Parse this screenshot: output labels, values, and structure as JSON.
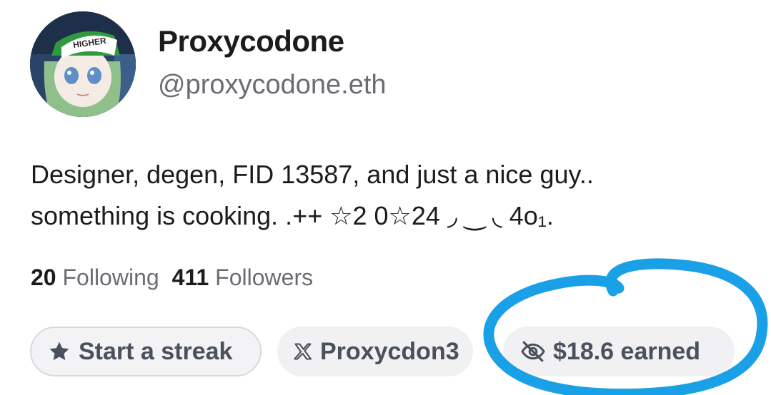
{
  "profile": {
    "display_name": "Proxycodone",
    "handle": "@proxycodone.eth",
    "avatar_cap_text": "HIGHER"
  },
  "bio": {
    "line1": "Designer, degen, FID 13587, and just a nice guy..",
    "line2": "something is cooking. .++ ☆2 0☆24 ◞ ‿ ◟ 4o₁."
  },
  "stats": {
    "following_count": "20",
    "following_label": "Following",
    "followers_count": "411",
    "followers_label": "Followers"
  },
  "actions": {
    "streak_label": "Start a streak",
    "x_label": "Proxycdon3",
    "earned_label": "$18.6 earned"
  },
  "icons": {
    "streak": "star-icon",
    "x": "x-logo-icon",
    "earned": "eye-slash-icon"
  },
  "colors": {
    "text_primary": "#1c1c1e",
    "text_secondary": "#6b6b73",
    "pill_bg": "#f1f1f3",
    "annotation": "#1aa0e6"
  }
}
